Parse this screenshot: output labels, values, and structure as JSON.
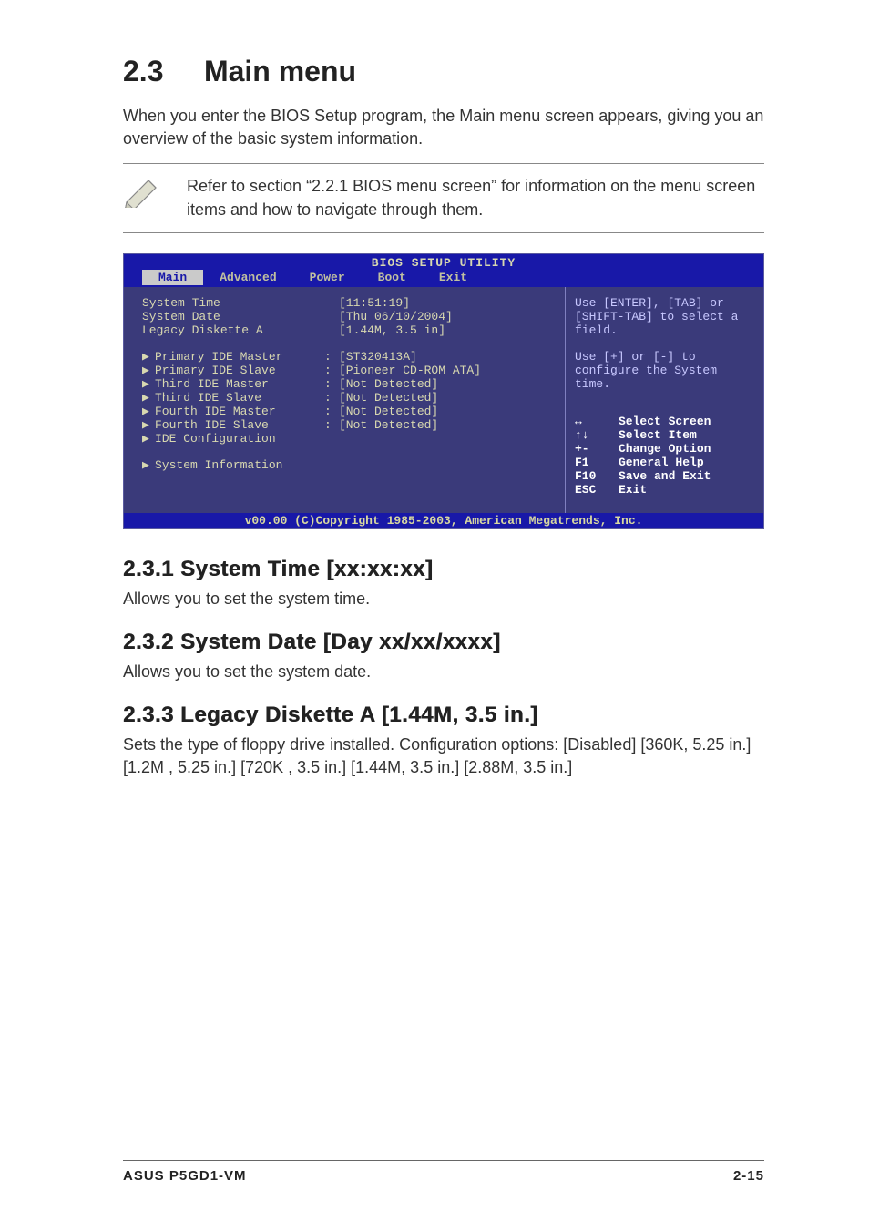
{
  "heading": {
    "number": "2.3",
    "title": "Main menu"
  },
  "intro": "When you enter the BIOS Setup program, the Main menu screen appears, giving you an overview of the basic system information.",
  "note": "Refer to section “2.2.1 BIOS menu screen” for information on the menu screen items and how to navigate through them.",
  "bios": {
    "title": "BIOS SETUP UTILITY",
    "tabs": [
      "Main",
      "Advanced",
      "Power",
      "Boot",
      "Exit"
    ],
    "active_tab": "Main",
    "top_rows": [
      {
        "label": "System Time",
        "value": "[11:51:19]"
      },
      {
        "label": "System Date",
        "value": "[Thu 06/10/2004]"
      },
      {
        "label": "Legacy Diskette A",
        "value": "[1.44M, 3.5 in]"
      }
    ],
    "ide_rows": [
      {
        "label": "Primary IDE Master",
        "sep": ":",
        "value": "[ST320413A]"
      },
      {
        "label": "Primary IDE Slave",
        "sep": ":",
        "value": "[Pioneer CD-ROM ATA]"
      },
      {
        "label": "Third IDE Master",
        "sep": ":",
        "value": "[Not Detected]"
      },
      {
        "label": "Third IDE Slave",
        "sep": ":",
        "value": "[Not Detected]"
      },
      {
        "label": "Fourth IDE Master",
        "sep": ":",
        "value": "[Not Detected]"
      },
      {
        "label": "Fourth IDE Slave",
        "sep": ":",
        "value": "[Not Detected]"
      },
      {
        "label": "IDE Configuration",
        "sep": "",
        "value": ""
      }
    ],
    "sysinfo": "System Information",
    "help1": "Use [ENTER], [TAB] or [SHIFT-TAB] to select a field.",
    "help2": "Use [+] or [-] to configure the System time.",
    "legend": [
      {
        "key": "↔",
        "val": "Select Screen"
      },
      {
        "key": "↑↓",
        "val": "Select Item"
      },
      {
        "key": "+-",
        "val": "Change Option"
      },
      {
        "key": "F1",
        "val": "General Help"
      },
      {
        "key": "F10",
        "val": "Save and Exit"
      },
      {
        "key": "ESC",
        "val": "Exit"
      }
    ],
    "footer": "v00.00 (C)Copyright 1985-2003, American Megatrends, Inc."
  },
  "sub1": {
    "title": "2.3.1   System Time [xx:xx:xx]",
    "text": "Allows you to set the system time."
  },
  "sub2": {
    "title": "2.3.2   System Date [Day xx/xx/xxxx]",
    "text": "Allows you to set the system date."
  },
  "sub3": {
    "title": "2.3.3   Legacy Diskette A [1.44M, 3.5 in.]",
    "text": "Sets the type of floppy drive installed. Configuration options: [Disabled] [360K, 5.25 in.] [1.2M , 5.25 in.] [720K , 3.5 in.] [1.44M, 3.5 in.] [2.88M, 3.5 in.]"
  },
  "footer": {
    "left": "ASUS P5GD1-VM",
    "right": "2-15"
  }
}
